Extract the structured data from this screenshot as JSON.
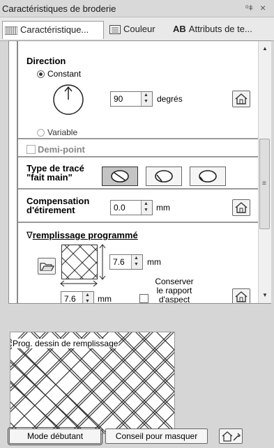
{
  "window": {
    "title": "Caractéristiques de broderie",
    "pin_icon": "pin-icon",
    "close_glyph": "×"
  },
  "tabs": [
    {
      "label": "Caractéristique...",
      "icon": "stitch-properties-icon",
      "active": true
    },
    {
      "label": "Couleur",
      "icon": "color-list-icon",
      "active": false
    },
    {
      "label": "Attributs de te...",
      "icon_text": "AB",
      "active": false
    }
  ],
  "direction": {
    "heading": "Direction",
    "constant_label": "Constant",
    "variable_label": "Variable",
    "angle_value": "90",
    "angle_unit": "degrés",
    "selected": "Constant"
  },
  "demi_point": {
    "label": "Demi-point",
    "checked": false
  },
  "type_trace": {
    "label_line1": "Type de tracé",
    "label_line2": "\"fait main\"",
    "selected_index": 0
  },
  "compensation": {
    "label_line1": "Compensation",
    "label_line2": "d'étirement",
    "value": "0.0",
    "unit": "mm"
  },
  "remplissage": {
    "heading_arrow": "∇",
    "heading": "remplissage programmé",
    "height_value": "7.6",
    "height_unit": "mm",
    "width_value": "7.6",
    "width_unit": "mm",
    "keep_ratio_line1": "Conserver",
    "keep_ratio_line2": "le rapport",
    "keep_ratio_line3": "d'aspect",
    "keep_ratio_checked": false
  },
  "preview": {
    "caption": "Prog. dessin de remplissage"
  },
  "bottom": {
    "beginner_button": "Mode débutant",
    "hint_button": "Conseil pour masquer"
  }
}
